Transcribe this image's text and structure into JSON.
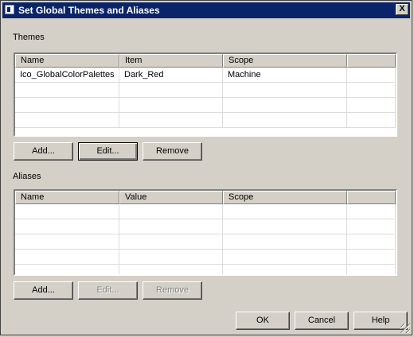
{
  "window": {
    "title": "Set Global Themes and Aliases",
    "close_label": "X"
  },
  "themes": {
    "label": "Themes",
    "columns": [
      "Name",
      "Item",
      "Scope",
      ""
    ],
    "rows": [
      [
        "Ico_GlobalColorPalettes",
        "Dark_Red",
        "Machine",
        ""
      ],
      [
        "",
        "",
        "",
        ""
      ],
      [
        "",
        "",
        "",
        ""
      ],
      [
        "",
        "",
        "",
        ""
      ],
      [
        "",
        "",
        "",
        ""
      ]
    ],
    "buttons": {
      "add": "Add...",
      "edit": "Edit...",
      "remove": "Remove"
    }
  },
  "aliases": {
    "label": "Aliases",
    "columns": [
      "Name",
      "Value",
      "Scope",
      ""
    ],
    "rows": [
      [
        "",
        "",
        "",
        ""
      ],
      [
        "",
        "",
        "",
        ""
      ],
      [
        "",
        "",
        "",
        ""
      ],
      [
        "",
        "",
        "",
        ""
      ],
      [
        "",
        "",
        "",
        ""
      ]
    ],
    "buttons": {
      "add": "Add...",
      "edit": "Edit...",
      "remove": "Remove"
    }
  },
  "footer": {
    "ok": "OK",
    "cancel": "Cancel",
    "help": "Help"
  }
}
